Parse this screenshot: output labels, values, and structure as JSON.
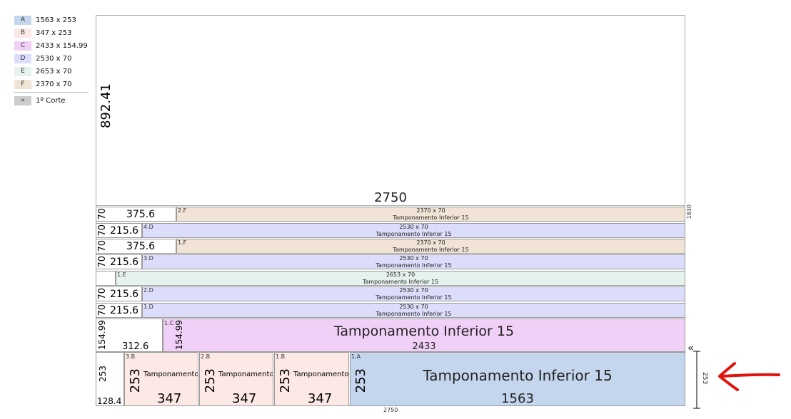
{
  "legend": {
    "items": [
      {
        "code": "A",
        "size": "1563 x 253",
        "color": "#c3d6ee"
      },
      {
        "code": "B",
        "size": "347 x 253",
        "color": "#fce9e6"
      },
      {
        "code": "C",
        "size": "2433 x 154.99",
        "color": "#f0d0f6"
      },
      {
        "code": "D",
        "size": "2530 x 70",
        "color": "#dcdcfb"
      },
      {
        "code": "E",
        "size": "2653 x 70",
        "color": "#e6f2ec"
      },
      {
        "code": "F",
        "size": "2370 x 70",
        "color": "#f1e3d5"
      }
    ],
    "cut": {
      "symbol": "»",
      "label": "1º Corte"
    }
  },
  "sheet": {
    "width_label": "2750",
    "height_label": "1830",
    "waste_top": {
      "height_label": "892.41",
      "width_label": "2750"
    }
  },
  "strips": [
    {
      "label": "2.F",
      "size": "2370 x 70",
      "name": "Tamponamento Inferior 15",
      "waste_w": "375.6",
      "waste_h": "70",
      "color": "#f1e3d5"
    },
    {
      "label": "4.D",
      "size": "2530 x 70",
      "name": "Tamponamento Inferior 15",
      "waste_w": "215.6",
      "waste_h": "70",
      "color": "#dcdcfb"
    },
    {
      "label": "1.F",
      "size": "2370 x 70",
      "name": "Tamponamento Inferior 15",
      "waste_w": "375.6",
      "waste_h": "70",
      "color": "#f1e3d5"
    },
    {
      "label": "3.D",
      "size": "2530 x 70",
      "name": "Tamponamento Inferior 15",
      "waste_w": "215.6",
      "waste_h": "70",
      "color": "#dcdcfb"
    },
    {
      "label": "1.E",
      "size": "2653 x 70",
      "name": "Tamponamento Inferior 15",
      "waste_w": "",
      "waste_h": "",
      "color": "#e6f2ec"
    },
    {
      "label": "2.D",
      "size": "2530 x 70",
      "name": "Tamponamento Inferior 15",
      "waste_w": "215.6",
      "waste_h": "70",
      "color": "#dcdcfb"
    },
    {
      "label": "1.D",
      "size": "2530 x 70",
      "name": "Tamponamento Inferior 15",
      "waste_w": "215.6",
      "waste_h": "70",
      "color": "#dcdcfb"
    }
  ],
  "piece_c": {
    "label": "1.C",
    "name": "Tamponamento Inferior 15",
    "width": "2433",
    "height": "154.99",
    "waste_w": "312.6",
    "waste_h": "154.99",
    "color": "#f0d0f6"
  },
  "bottom_row": {
    "waste": {
      "w": "128.4",
      "h": "253"
    },
    "pieces": [
      {
        "label": "3.B",
        "name": "Tamponamento",
        "w": "347",
        "h": "253",
        "color": "#fce9e6"
      },
      {
        "label": "2.B",
        "name": "Tamponamento",
        "w": "347",
        "h": "253",
        "color": "#fce9e6"
      },
      {
        "label": "1.B",
        "name": "Tamponamento",
        "w": "347",
        "h": "253",
        "color": "#fce9e6"
      },
      {
        "label": "1.A",
        "name": "Tamponamento Inferior 15",
        "w": "1563",
        "h": "253",
        "color": "#c3d6ee"
      }
    ],
    "cut_marker": "«",
    "cut_height": "253"
  },
  "annotation_color": "#e0140e"
}
